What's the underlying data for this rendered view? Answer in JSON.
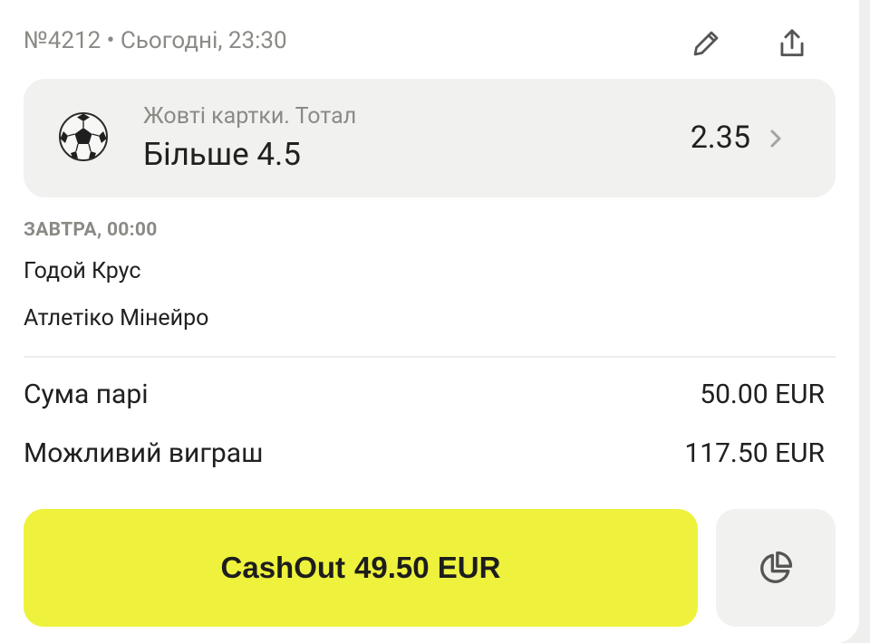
{
  "header": {
    "bet_number": "№4212",
    "separator": "•",
    "placed_at": "Сьогодні, 23:30",
    "edit_icon": "pencil-icon",
    "share_icon": "share-icon"
  },
  "outcome": {
    "sport_icon": "soccer-ball-icon",
    "market": "Жовті картки. Тотал",
    "selection": "Більше 4.5",
    "odds": "2.35",
    "chevron_icon": "chevron-right-icon"
  },
  "event": {
    "start": "ЗАВТРА, 00:00",
    "home_team": "Годой Крус",
    "away_team": "Атлетіко Мінейро"
  },
  "summary": [
    {
      "label": "Сума парі",
      "value": "50.00 EUR"
    },
    {
      "label": "Можливий виграш",
      "value": "117.50 EUR"
    }
  ],
  "actions": {
    "cashout_label": "CashOut",
    "cashout_amount": "49.50 EUR",
    "partial_icon": "pie-chart-icon"
  },
  "colors": {
    "accent": "#eef23c",
    "surface": "#f1f1ef",
    "muted_text": "#8a8a86",
    "text": "#202020"
  }
}
